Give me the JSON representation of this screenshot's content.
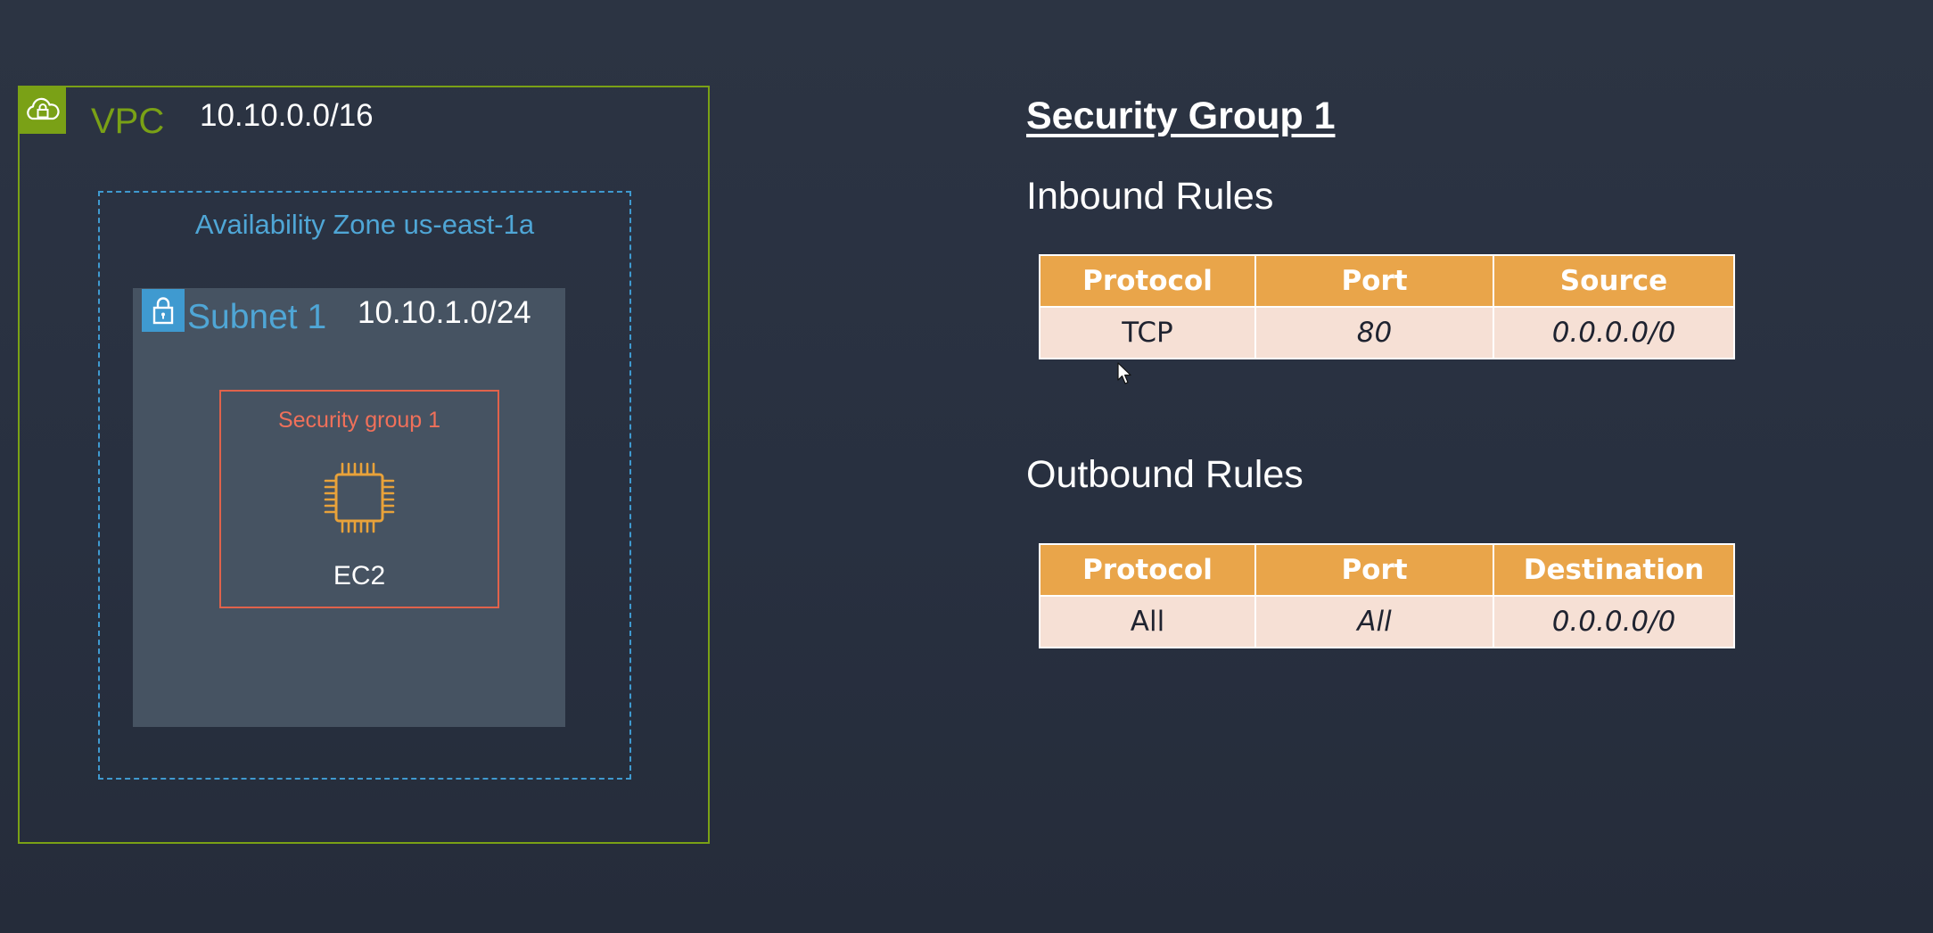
{
  "diagram": {
    "vpc": {
      "label": "VPC",
      "cidr": "10.10.0.0/16",
      "icon": "cloud-lock-icon"
    },
    "availability_zone": {
      "label": "Availability Zone us-east-1a"
    },
    "subnet": {
      "label": "Subnet 1",
      "cidr": "10.10.1.0/24",
      "icon": "lock-icon"
    },
    "security_group": {
      "label": "Security group 1"
    },
    "instance": {
      "label": "EC2",
      "icon": "ec2-chip-icon"
    }
  },
  "panel": {
    "title": "Security Group 1",
    "inbound": {
      "heading": "Inbound Rules",
      "columns": [
        "Protocol",
        "Port",
        "Source"
      ],
      "rows": [
        {
          "protocol": "TCP",
          "port": "80",
          "source": "0.0.0.0/0"
        }
      ]
    },
    "outbound": {
      "heading": "Outbound Rules",
      "columns": [
        "Protocol",
        "Port",
        "Destination"
      ],
      "rows": [
        {
          "protocol": "All",
          "port": "All",
          "destination": "0.0.0.0/0"
        }
      ]
    }
  },
  "colors": {
    "vpc": "#7aa116",
    "availability_zone": "#3f9ad0",
    "subnet_fill": "#465362",
    "security_group": "#e0624b",
    "ec2": "#e8a23a",
    "table_header": "#e9a54a",
    "table_cell": "#f6e0d5"
  }
}
